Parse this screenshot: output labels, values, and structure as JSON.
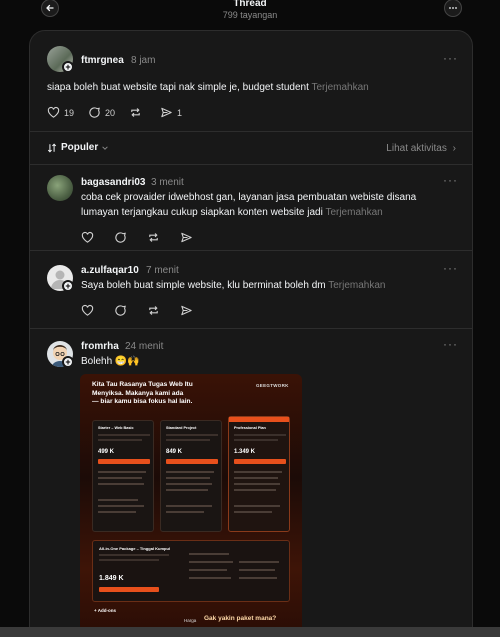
{
  "header": {
    "title": "Thread",
    "views": "799 tayangan"
  },
  "main_post": {
    "username": "ftmrgnea",
    "time": "8 jam",
    "text": "siapa boleh buat website tapi nak simple je, budget student",
    "translate": "Terjemahkan",
    "likes": "19",
    "comments": "20",
    "shares": "1"
  },
  "sort": {
    "label": "Populer",
    "activity": "Lihat aktivitas"
  },
  "replies": [
    {
      "username": "bagasandri03",
      "time": "3 menit",
      "line1": "coba cek provaider idwebhost gan, layanan jasa pembuatan webiste disana",
      "line2": "lumayan terjangkau cukup siapkan konten website jadi",
      "translate": "Terjemahkan"
    },
    {
      "username": "a.zulfaqar10",
      "time": "7 menit",
      "line1": "Saya boleh buat simple website, klu berminat boleh dm",
      "translate": "Terjemahkan"
    },
    {
      "username": "fromrha",
      "time": "24 menit",
      "line1": "Bolehh 😁🙌"
    }
  ],
  "promo": {
    "headline1": "Kita Tau Rasanya Tugas Web Itu",
    "headline2": "Menyiksa. Makanya kami ada",
    "headline3": "— biar kamu bisa fokus hal lain.",
    "brand": "GEEGTWORK",
    "plan1_name": "Starter – Web Basic",
    "plan1_price": "499 K",
    "plan2_name": "Standard Project",
    "plan2_price": "849 K",
    "plan3_name": "Professional Plan",
    "plan3_price": "1.349 K",
    "package_name": "All-in-One Package – Tinggal Kumpul",
    "package_price": "1.849 K",
    "addon": "Add-ons",
    "harga": "Harga",
    "cta": "Gak yakin paket mana?"
  },
  "colors": {
    "accent": "#e8501c",
    "background": "#0a0a0a",
    "panel": "#181818"
  }
}
